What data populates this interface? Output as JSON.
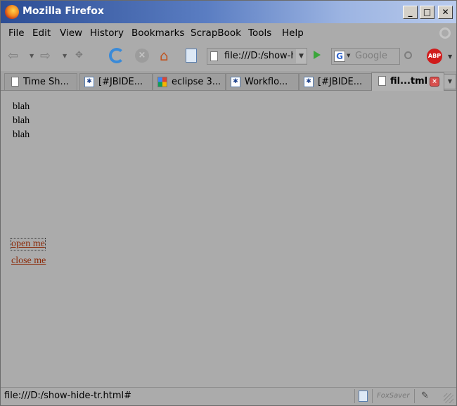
{
  "window": {
    "title": "Mozilla Firefox",
    "min_glyph": "_",
    "max_glyph": "□",
    "close_glyph": "✕"
  },
  "menu": {
    "items": [
      "File",
      "Edit",
      "View",
      "History",
      "Bookmarks",
      "ScrapBook",
      "Tools",
      "Help"
    ]
  },
  "nav": {
    "url": "file:///D:/show-hide-tr.html",
    "search_placeholder": "Google",
    "search_engine_letter": "G",
    "adblock_label": "ABP"
  },
  "tabs": [
    {
      "label": "Time Sh...",
      "icon": "page-icon"
    },
    {
      "label": "[#JBIDE...",
      "icon": "jboss-icon"
    },
    {
      "label": "eclipse 3...",
      "icon": "google-icon"
    },
    {
      "label": "Workflo...",
      "icon": "jboss-icon"
    },
    {
      "label": "[#JBIDE...",
      "icon": "jboss-icon"
    },
    {
      "label": "fil...tml",
      "icon": "page-icon",
      "active": true
    }
  ],
  "content": {
    "lines": [
      "blah",
      "blah",
      "blah"
    ],
    "open_link": "open me",
    "close_link": "close me"
  },
  "status": {
    "text": "file:///D:/show-hide-tr.html#",
    "foxsaver": "FoxSaver"
  },
  "colors": {
    "link": "#8b2b0a",
    "background": "#ababab",
    "titlebar_start": "#2c4d94"
  }
}
